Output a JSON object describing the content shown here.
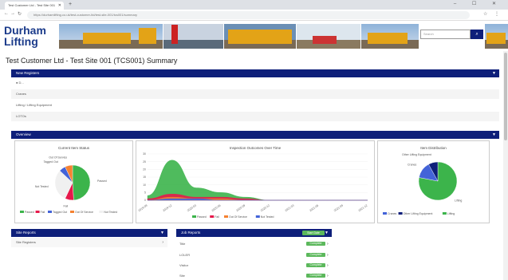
{
  "browser": {
    "tab_title": "Test Customer Ltd - Test Site 001",
    "new_tab": "+",
    "url": "https://durhamlifting.co.uk/test-customer-ltd/test-site-001/tcs001/summary",
    "window_controls": "– ☐ ✕"
  },
  "header": {
    "logo_line1": "Durham",
    "logo_line2": "Lifting",
    "search_placeholder": "Search",
    "search_icon": "search-icon"
  },
  "page": {
    "title": "Test Customer Ltd - Test Site 001 (TCS001) Summary"
  },
  "new_registers": {
    "label": "New Registers",
    "rows": [
      "● D...",
      "Cranes",
      "Lifting / Lifting Equipment",
      "LOTOs"
    ]
  },
  "overview": {
    "label": "Overview"
  },
  "site_reports": {
    "label": "Site Reports",
    "rows": [
      "Site Registers"
    ]
  },
  "job_reports": {
    "label": "Job Reports",
    "badge": "Start Date",
    "rows": [
      {
        "label": "Title",
        "status": "Complete"
      },
      {
        "label": "LOLER",
        "status": "Complete"
      },
      {
        "label": "Visitor",
        "status": "Complete"
      },
      {
        "label": "Site",
        "status": "Complete"
      }
    ]
  },
  "chart_data": [
    {
      "type": "pie",
      "title": "Current Item Status",
      "slices": [
        {
          "label": "Passed",
          "value": 49,
          "color": "#3cb44b"
        },
        {
          "label": "Fail",
          "value": 8,
          "color": "#e6194b"
        },
        {
          "label": "Not Tested",
          "value": 30,
          "color": "#f0f0f0"
        },
        {
          "label": "Tagged Out",
          "value": 6,
          "color": "#4363d8"
        },
        {
          "label": "Out Of Service",
          "value": 7,
          "color": "#f58231"
        }
      ],
      "legend": [
        "Passed",
        "Fail",
        "Tagged Out",
        "Out Of Service",
        "Not Tested"
      ]
    },
    {
      "type": "area",
      "title": "Inspection Outcomes Over Time",
      "x": [
        "2019-09",
        "2019-12",
        "2020-03",
        "2020-06",
        "2020-09",
        "2020-12",
        "2021-03",
        "2021-06",
        "2021-09",
        "2021-12"
      ],
      "ylim": [
        0,
        30
      ],
      "yticks": [
        0,
        5,
        10,
        15,
        20,
        25,
        30
      ],
      "series": [
        {
          "name": "Passed",
          "color": "#3cb44b",
          "values": [
            3,
            26,
            8,
            5,
            2,
            0,
            0,
            0,
            0,
            0
          ]
        },
        {
          "name": "Fail",
          "color": "#e6194b",
          "values": [
            1,
            4,
            2,
            2,
            1,
            0,
            0,
            0,
            0,
            0
          ]
        },
        {
          "name": "Out Of Service",
          "color": "#f58231",
          "values": [
            0,
            2,
            1,
            1,
            0,
            0,
            0,
            0,
            0,
            0
          ]
        },
        {
          "name": "Not Tested",
          "color": "#4363d8",
          "values": [
            0,
            1,
            1,
            0,
            0,
            0,
            0,
            0,
            0,
            0
          ]
        }
      ]
    },
    {
      "type": "pie",
      "title": "Item Distribution",
      "slices": [
        {
          "label": "Lifting",
          "value": 78,
          "color": "#3cb44b"
        },
        {
          "label": "Cranes",
          "value": 14,
          "color": "#4363d8"
        },
        {
          "label": "Other Lifting Equipment",
          "value": 8,
          "color": "#0e1f7a"
        }
      ],
      "legend": [
        "Cranes",
        "Other Lifting Equipment",
        "Lifting"
      ]
    }
  ]
}
